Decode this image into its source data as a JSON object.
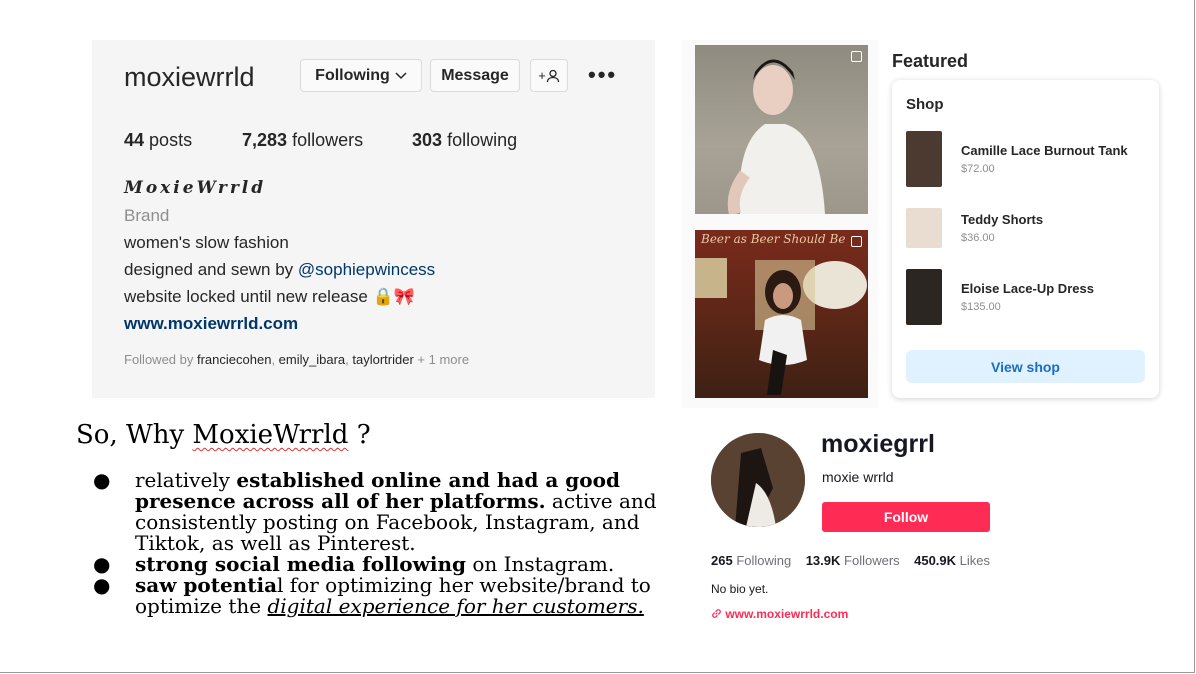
{
  "instagram": {
    "username": "moxiewrrld",
    "following_button": "Following",
    "message_button": "Message",
    "add_user_label": "+",
    "more_label": "•••",
    "stats": {
      "posts_num": "44",
      "posts_label": "posts",
      "followers_num": "7,283",
      "followers_label": "followers",
      "following_num": "303",
      "following_label": "following"
    },
    "display_name": "MoxieWrrld",
    "category": "Brand",
    "bio": {
      "line1": "women's slow fashion",
      "line2_prefix": "designed and sewn by ",
      "line2_handle": "@sophiepwincess",
      "line3": "website locked until new release 🔒🎀",
      "website": "www.moxiewrrld.com"
    },
    "followed_by": {
      "prefix": "Followed by ",
      "user1": "franciecohen",
      "user2": "emily_ibara",
      "user3": "taylortrider",
      "sep": ", ",
      "more": " + 1 more"
    }
  },
  "photos": {
    "photo2_sign": "Beer as Beer Should Be"
  },
  "featured": {
    "title": "Featured",
    "shop_label": "Shop",
    "items": [
      {
        "name": "Camille Lace Burnout Tank",
        "price": "$72.00",
        "color": "#4a3a30"
      },
      {
        "name": "Teddy Shorts",
        "price": "$36.00",
        "color": "#e9ddd2"
      },
      {
        "name": "Eloise Lace-Up Dress",
        "price": "$135.00",
        "color": "#2b2622"
      }
    ],
    "view_shop": "View shop"
  },
  "slide": {
    "heading_prefix": "So, Why ",
    "heading_brand": "MoxieWrrld",
    "heading_suffix": " ?",
    "bullet_char": "●",
    "b1_plain": "relatively ",
    "b1_bold": "established online and had a good presence across all of her platforms.",
    "b1_rest": " active and consistently posting on Facebook, Instagram, and Tiktok, as well as Pinterest.",
    "b2_bold": "strong social media following",
    "b2_rest": " on Instagram.",
    "b3_bold": "saw potentia",
    "b3_rest": "l for optimizing her website/brand to optimize the ",
    "b3_ital": "digital experience for her customers."
  },
  "tiktok": {
    "username": "moxiegrrl",
    "name": "moxie wrrld",
    "follow_button": "Follow",
    "following_num": "265",
    "following_label": "Following",
    "followers_num": "13.9K",
    "followers_label": "Followers",
    "likes_num": "450.9K",
    "likes_label": "Likes",
    "bio": "No bio yet.",
    "link": "www.moxiewrrld.com"
  },
  "colors": {
    "tiktok_red": "#fe2c55",
    "ig_link": "#00376b",
    "shop_button_bg": "#e0f1ff"
  }
}
